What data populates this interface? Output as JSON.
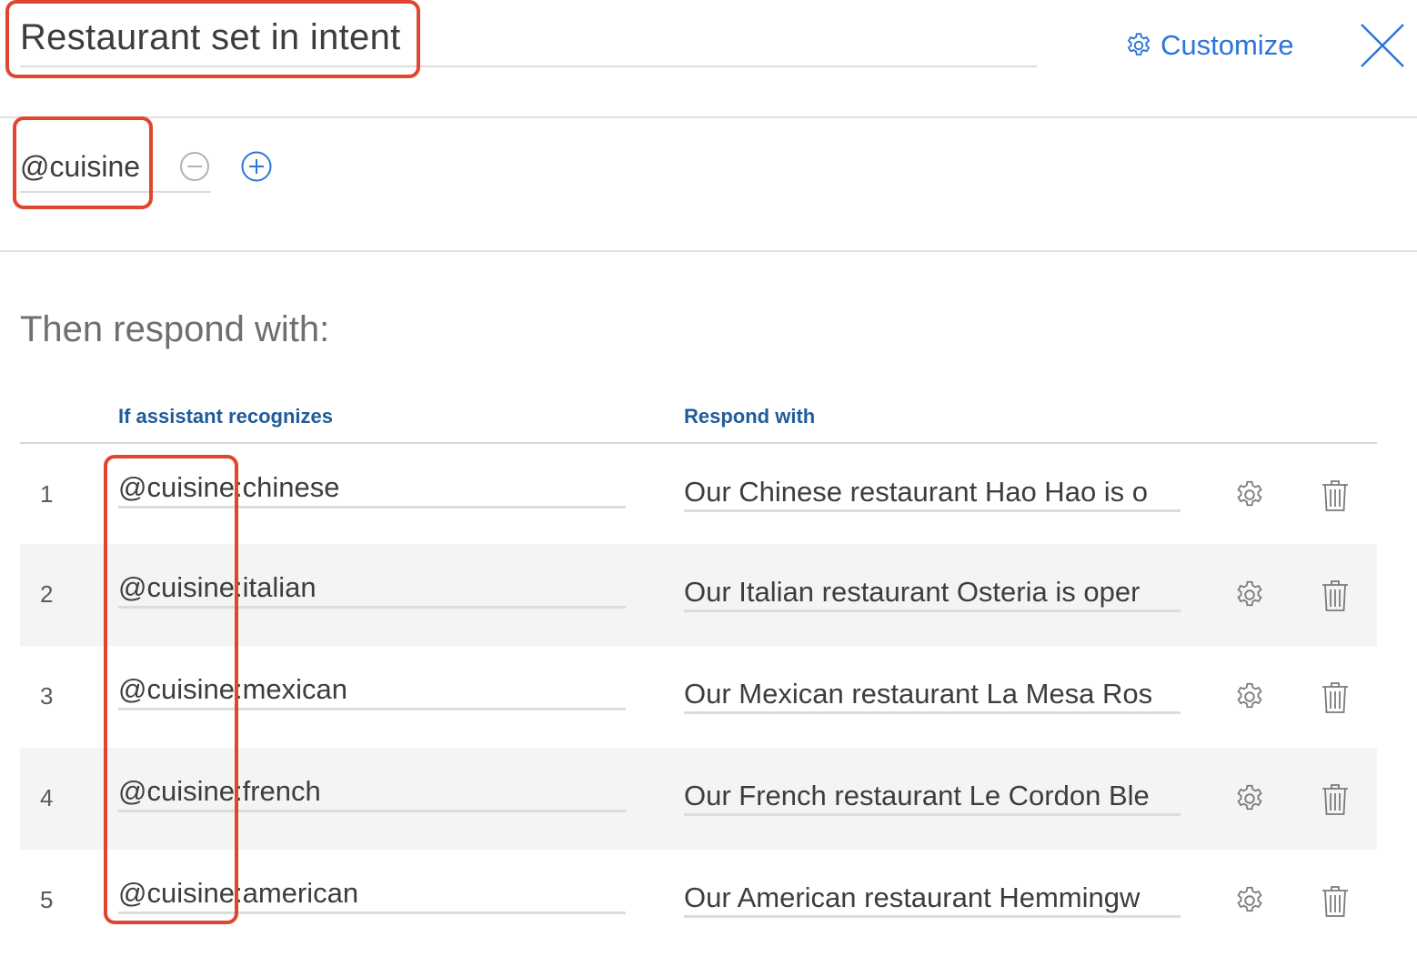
{
  "node": {
    "title": "Restaurant set in intent",
    "customize_label": "Customize"
  },
  "condition": {
    "value": "@cuisine"
  },
  "response_section": {
    "heading": "Then respond with:",
    "columns": {
      "condition": "If assistant recognizes",
      "response": "Respond with"
    },
    "rows": [
      {
        "num": "1",
        "condition": "@cuisine:chinese",
        "response": "Our Chinese restaurant Hao Hao is o"
      },
      {
        "num": "2",
        "condition": "@cuisine:italian",
        "response": "Our Italian restaurant Osteria is oper"
      },
      {
        "num": "3",
        "condition": "@cuisine:mexican",
        "response": "Our Mexican restaurant La Mesa Ros"
      },
      {
        "num": "4",
        "condition": "@cuisine:french",
        "response": "Our French restaurant Le Cordon Ble"
      },
      {
        "num": "5",
        "condition": "@cuisine:american",
        "response": "Our American restaurant Hemmingw"
      }
    ]
  },
  "icons": {
    "customize": "gear-icon",
    "close": "close-icon",
    "remove_condition": "minus-circle-icon",
    "add_condition": "plus-circle-icon",
    "row_settings": "gear-icon",
    "row_delete": "trash-icon"
  },
  "colors": {
    "link": "#2d74da",
    "column_header": "#1f5c99",
    "annotation": "#e0452f",
    "row_alt": "#f4f4f4"
  }
}
